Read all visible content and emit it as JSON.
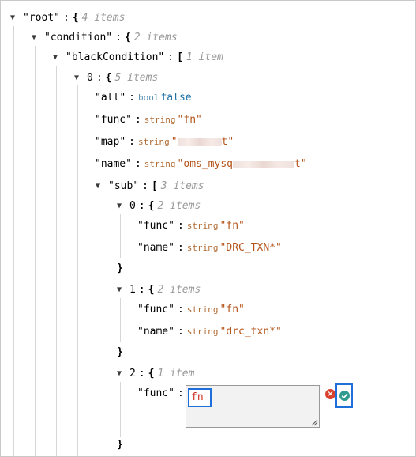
{
  "colors": {
    "string_value": "#b4541a",
    "bool_value": "#1d6fa5",
    "type_label": "#b06a32",
    "count_label": "#999999",
    "highlight": "#1e6fd9",
    "cancel": "#d9412f",
    "confirm": "#2f9a8e"
  },
  "icons": {
    "expanded": "caret-down-icon",
    "cancel": "cancel-x-icon",
    "confirm": "confirm-check-icon",
    "resize": "resize-grip-icon"
  },
  "tree": {
    "root": {
      "key": "root",
      "open": "{",
      "count": "4 items"
    },
    "condition": {
      "key": "condition",
      "open": "{",
      "count": "2 items"
    },
    "blackCondition": {
      "key": "blackCondition",
      "open": "[",
      "count": "1 item"
    },
    "item0": {
      "key": "0",
      "open": "{",
      "count": "5 items"
    },
    "all": {
      "key": "all",
      "type": "bool",
      "value": "false"
    },
    "func": {
      "key": "func",
      "type": "string",
      "value": "\"fn\""
    },
    "map": {
      "key": "map",
      "type": "string",
      "value_prefix": "\"",
      "value_suffix": "t\""
    },
    "name": {
      "key": "name",
      "type": "string",
      "value_prefix": "\"oms_mysq",
      "value_suffix": "t\""
    },
    "sub": {
      "key": "sub",
      "open": "[",
      "count": "3 items"
    },
    "sub0": {
      "key": "0",
      "open": "{",
      "count": "2 items",
      "close": "}",
      "func": {
        "key": "func",
        "type": "string",
        "value": "\"fn\""
      },
      "name": {
        "key": "name",
        "type": "string",
        "value": "\"DRC_TXN*\""
      }
    },
    "sub1": {
      "key": "1",
      "open": "{",
      "count": "2 items",
      "close": "}",
      "func": {
        "key": "func",
        "type": "string",
        "value": "\"fn\""
      },
      "name": {
        "key": "name",
        "type": "string",
        "value": "\"drc_txn*\""
      }
    },
    "sub2": {
      "key": "2",
      "open": "{",
      "count": "1 item",
      "close": "}",
      "func": {
        "key": "func",
        "editor_value": "fn"
      }
    }
  }
}
